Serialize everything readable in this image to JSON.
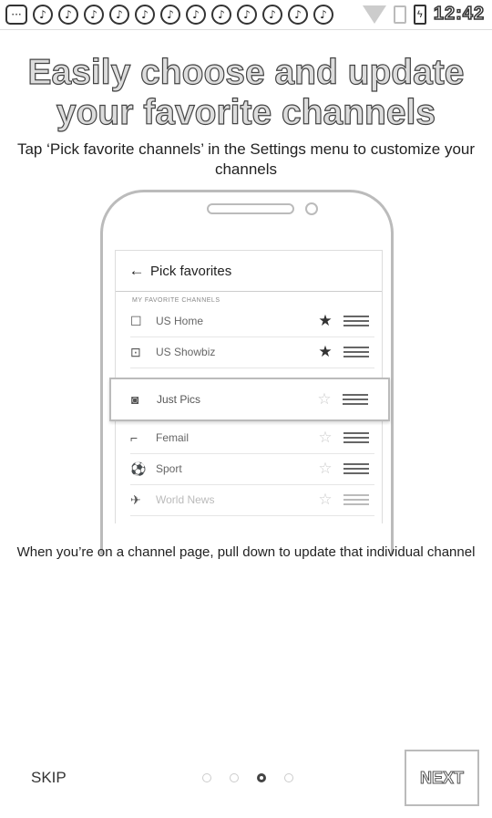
{
  "status_bar": {
    "icons": [
      "menu-icon",
      "notification-icon",
      "notification-icon",
      "notification-icon",
      "notification-icon",
      "notification-icon",
      "notification-icon",
      "notification-icon",
      "notification-icon",
      "notification-icon",
      "notification-icon",
      "notification-icon",
      "notification-icon"
    ],
    "time": "12:42"
  },
  "onboarding": {
    "title": "Easily choose and update your favorite channels",
    "subtitle": "Tap ‘Pick favorite channels’ in the Settings menu to customize your channels",
    "note": "When you’re on a channel page, pull down to update that individual channel"
  },
  "mockup": {
    "appbar_title": "Pick favorites",
    "section_label": "MY FAVORITE CHANNELS",
    "rows": [
      {
        "label": "US Home",
        "icon": "home-icon",
        "starred": true
      },
      {
        "label": "US Showbiz",
        "icon": "star-box-icon",
        "starred": true
      },
      {
        "label": "Femail",
        "icon": "shoe-icon",
        "starred": false
      },
      {
        "label": "Sport",
        "icon": "football-icon",
        "starred": false
      },
      {
        "label": "World News",
        "icon": "globe-icon",
        "starred": false
      }
    ],
    "dragged_row": {
      "label": "Just Pics",
      "icon": "camera-icon",
      "starred": false
    }
  },
  "footer": {
    "skip_label": "SKIP",
    "next_label": "NEXT",
    "page_count": 4,
    "current_page": 3
  }
}
